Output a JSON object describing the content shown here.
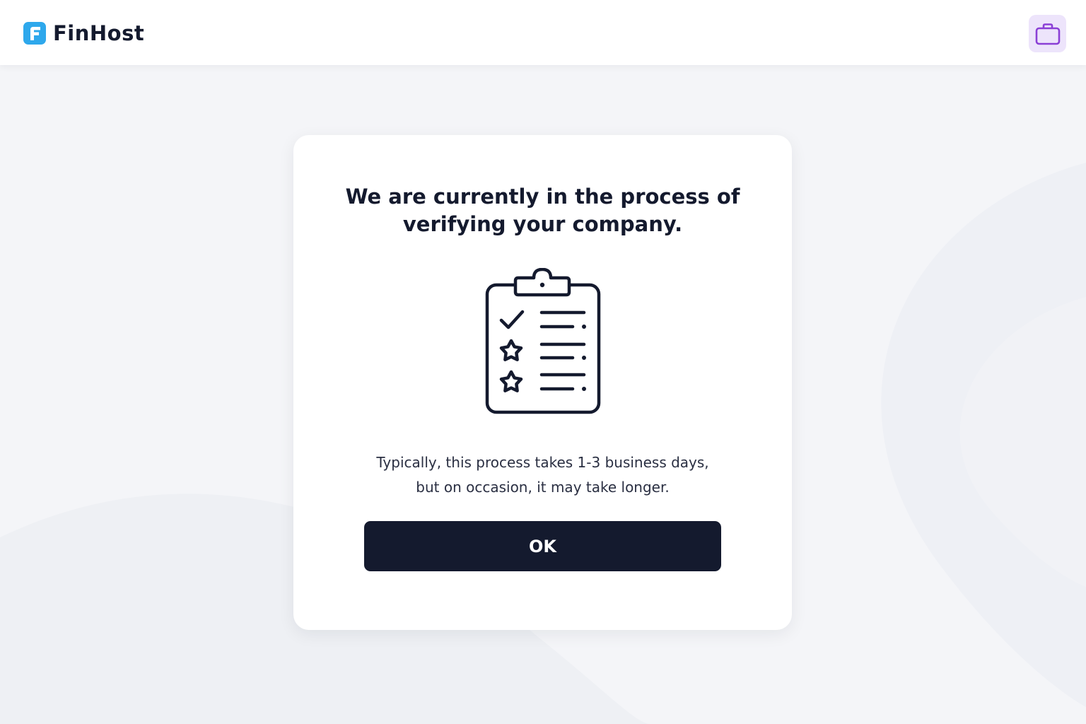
{
  "header": {
    "brand_name": "FinHost",
    "logo_icon": "finhost-logo-icon",
    "action_icon": "briefcase-icon"
  },
  "dialog": {
    "title": "We are currently in the process of verifying your company.",
    "illustration_icon": "clipboard-checklist-icon",
    "message_line1": "Typically, this process takes 1-3 business days,",
    "message_line2": "but on occasion, it may take longer.",
    "ok_label": "OK"
  },
  "colors": {
    "brand_dark": "#141a2e",
    "logo_blue": "#2ea8ec",
    "briefcase_bg": "#ede4fb",
    "briefcase_stroke": "#8b3fd6",
    "page_bg": "#f4f5f8",
    "card_bg": "#ffffff"
  }
}
